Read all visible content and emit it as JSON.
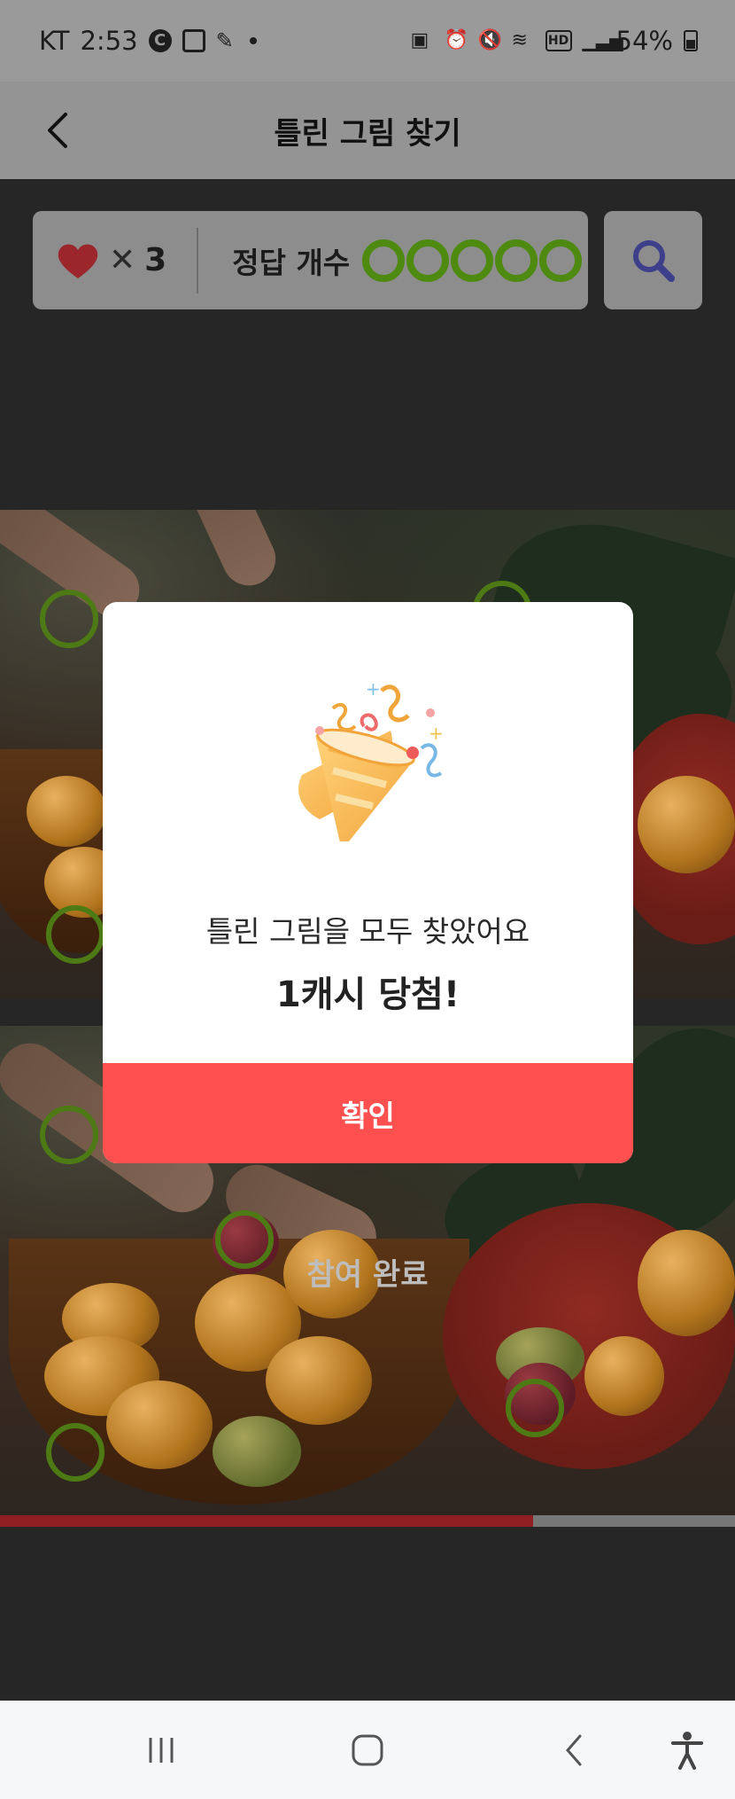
{
  "status_bar": {
    "carrier": "KT",
    "time": "2:53",
    "battery": "54%",
    "left_icons": [
      "c-icon",
      "gallery-icon",
      "tiktok-icon"
    ],
    "right_icons": [
      "nfc-icon",
      "alarm-icon",
      "mute-icon",
      "wifi-icon",
      "hd-icon",
      "signal-icon",
      "battery-icon"
    ]
  },
  "header": {
    "title": "틀린 그림 찾기",
    "back_icon": "chevron-left-icon"
  },
  "game_info": {
    "lives_symbol": "✕",
    "lives_count": "3",
    "answer_label": "정답 개수",
    "answers_found": 5,
    "answers_total": 5,
    "heart_color": "#9b262b",
    "circle_color": "#4f8a10",
    "hint_icon": "search-icon"
  },
  "photo": {
    "participation_text": "참여 완료"
  },
  "progress": {
    "fraction": 0.725,
    "fill_color": "#8f1f22"
  },
  "modal": {
    "icon": "party-popper-icon",
    "message": "틀린 그림을 모두 찾았어요",
    "reward": "1캐시 당첨!",
    "confirm_label": "확인",
    "button_color": "#ff4f4f"
  },
  "nav_bar": {
    "items": [
      "recent-apps-icon",
      "home-icon",
      "back-icon",
      "accessibility-icon"
    ]
  }
}
